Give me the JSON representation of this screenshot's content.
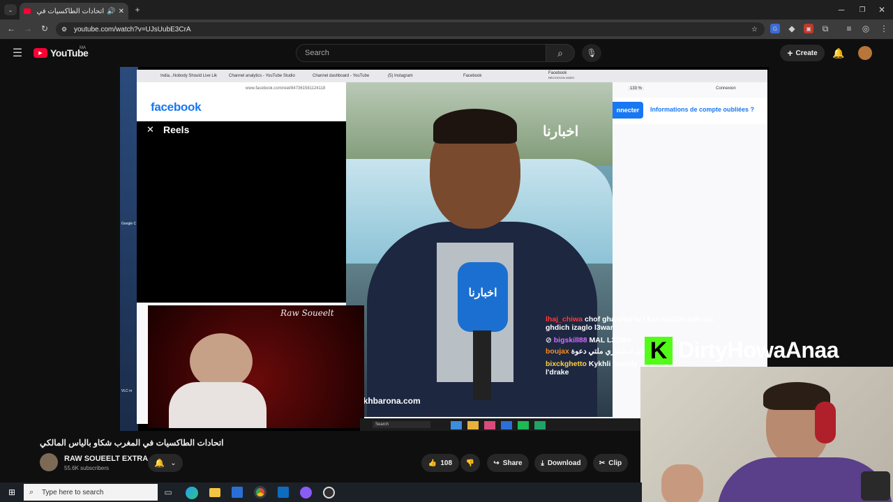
{
  "browser": {
    "tab_title": "اتحادات الطاكسيات في المغ",
    "url": "youtube.com/watch?v=UJsUubE3CrA"
  },
  "youtube": {
    "logo": "YouTube",
    "region": "MA",
    "search_placeholder": "Search",
    "create_label": "Create"
  },
  "video": {
    "firefox_tabs": [
      "India...Nobody Should Live Lik",
      "Channel analytics - YouTube Studio",
      "Channel dashboard - YouTube",
      "(5) Instagram",
      "Facebook",
      "Facebook"
    ],
    "firefox_tab_sub": "RÉCITATION VIDÉO",
    "firefox_url": "www.facebook.com/reel/847361581124118",
    "zoom": "133 %",
    "connexion": "Connexion",
    "facebook_logo": "facebook",
    "reels_label": "Reels",
    "connect_label": "nnecter",
    "forgot_label": "Informations de compte oubliées ?",
    "akhbarona_watermark": "Akhbarona.com",
    "akhbarona_logo": "اخبارنا",
    "streamer_overlay": "Raw Soueelt",
    "inner_search": "Search",
    "desktop_labels": [
      "Google C",
      "VLC m"
    ]
  },
  "chat": [
    {
      "user": "lhaj_chiwa",
      "msg": "chof gha chof tv l kan hadchi bsh ma",
      "msg2": "ghdich izaglo l3war",
      "color": "#ff3b3b"
    },
    {
      "user": "bigskill88",
      "msg": "MAL L3ZWA",
      "color": "#d66bff"
    },
    {
      "user": "boujax",
      "msg": "بيان استنكاري ملتي دعوة",
      "color": "#ff8c1a"
    },
    {
      "user": "bixckghetto",
      "msg": "Kykhli Spotify",
      "msg2": "l'drake",
      "color": "#ffd43b"
    }
  ],
  "kick_name": "DirtyHowaAnaa",
  "meta": {
    "title": "اتحادات الطاكسيات في المغرب شكاو بالياس المالكي",
    "channel": "RAW SOUEELT EXTRA",
    "subscribers": "55.6K subscribers",
    "likes": "108",
    "share": "Share",
    "download": "Download",
    "clip": "Clip"
  },
  "taskbar": {
    "search_placeholder": "Type here to search"
  },
  "colors": {
    "youtube_red": "#ff0033",
    "kick_green": "#53fc18",
    "fb_blue": "#1877f2"
  }
}
